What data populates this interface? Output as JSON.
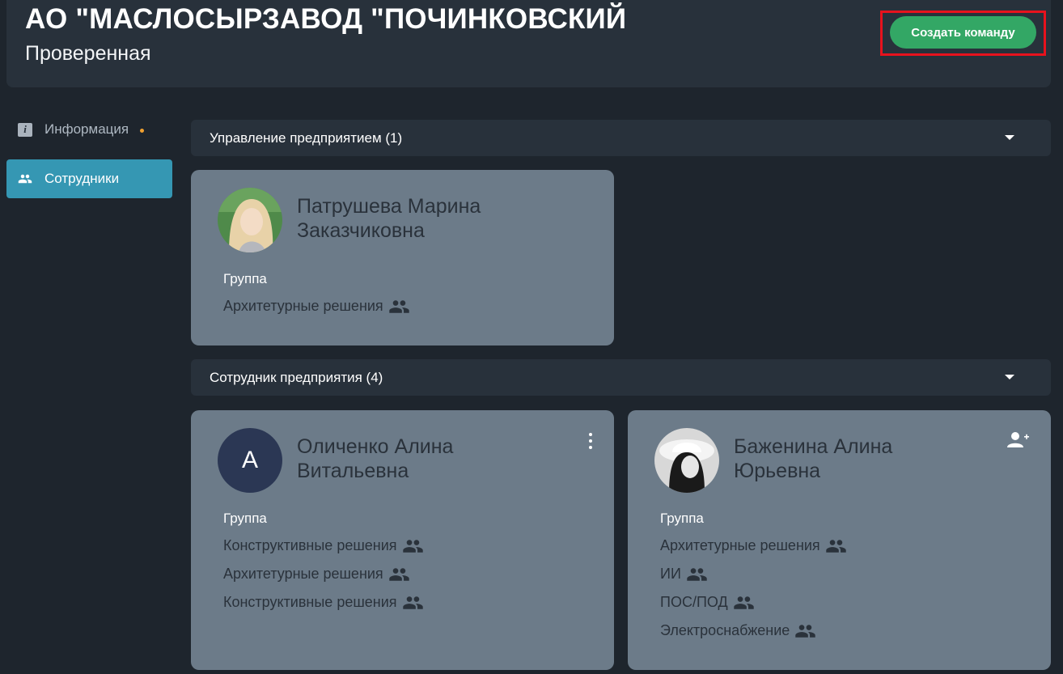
{
  "header": {
    "title": "АО \"МАСЛОСЫРЗАВОД \"ПОЧИНКОВСКИЙ",
    "status": "Проверенная",
    "create_team_label": "Создать команду"
  },
  "sidebar": {
    "items": [
      {
        "label": "Информация",
        "icon": "info-icon"
      },
      {
        "label": "Сотрудники",
        "icon": "people-icon",
        "active": true
      }
    ]
  },
  "sections": [
    {
      "title": "Управление предприятием (1)",
      "people": [
        {
          "name": "Патрушева Марина Заказчиковна",
          "avatar": "photo",
          "group_label": "Группа",
          "teams": [
            "Архитетурные решения"
          ]
        }
      ]
    },
    {
      "title": "Сотрудник предприятия (4)",
      "people": [
        {
          "name": "Оличенко Алина Витальевна",
          "avatar_letter": "А",
          "group_label": "Группа",
          "teams": [
            "Конструктивные решения",
            "Архитетурные решения",
            "Конструктивные решения"
          ]
        },
        {
          "name": "Баженина Алина Юрьевна",
          "avatar": "photo",
          "group_label": "Группа",
          "teams": [
            "Архитетурные решения",
            "ИИ",
            "ПОС/ПОД",
            "Электроснабжение"
          ]
        }
      ]
    }
  ],
  "colors": {
    "background": "#1e252d",
    "panel": "#28313b",
    "card": "#6c7b89",
    "accent": "#3597b3",
    "create_button": "#33a765",
    "highlight_border": "#e8121d"
  }
}
